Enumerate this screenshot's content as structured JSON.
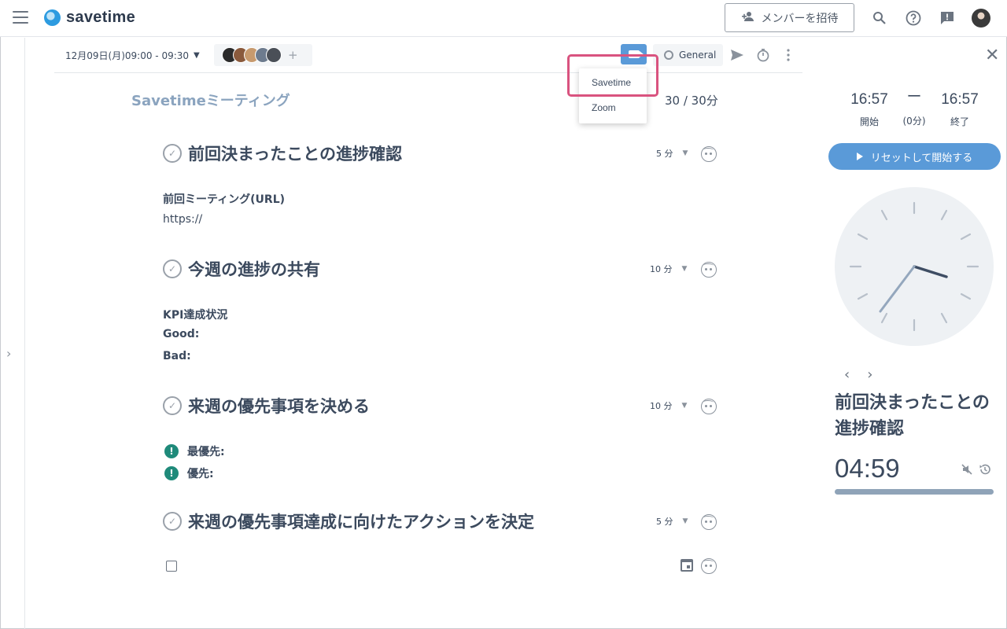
{
  "header": {
    "logo_text": "savetime",
    "invite_label": "メンバーを招待"
  },
  "meeting_bar": {
    "date_time": "12月09日(月)09:00 - 09:30",
    "channel": "General",
    "add_member": "+"
  },
  "dropdown": {
    "options": [
      "Savetime",
      "Zoom"
    ]
  },
  "meeting": {
    "title": "Savetimeミーティング",
    "time_used": "30 / 30分"
  },
  "agenda": [
    {
      "title": "前回決まったことの進捗確認",
      "duration": "5 分",
      "notes": [
        "前回ミーティング(URL)",
        "https://"
      ]
    },
    {
      "title": "今週の進捗の共有",
      "duration": "10 分",
      "notes": [
        "KPI達成状況",
        "Good:",
        "Bad:"
      ]
    },
    {
      "title": "来週の優先事項を決める",
      "duration": "10 分",
      "priorities": [
        "最優先:",
        "優先:"
      ],
      "priority_badge": "!"
    },
    {
      "title": "来週の優先事項達成に向けたアクションを決定",
      "duration": "5 分"
    }
  ],
  "timer": {
    "start_time": "16:57",
    "start_label": "開始",
    "dash": "ー",
    "elapsed": "(0分)",
    "end_time": "16:57",
    "end_label": "終了",
    "reset_button": "リセットして開始する",
    "current_item": "前回決まったことの進捗確認",
    "countdown": "04:59"
  },
  "icons": {
    "menu": "hamburger-icon",
    "search": "search-icon",
    "help": "help-icon",
    "feedback": "feedback-icon",
    "send": "send-icon",
    "stopwatch": "stopwatch-icon",
    "more": "more-vert-icon",
    "close": "close-icon"
  },
  "colors": {
    "accent": "#5a9ad8",
    "highlight": "#d9537f",
    "priority": "#1f8a7a"
  }
}
